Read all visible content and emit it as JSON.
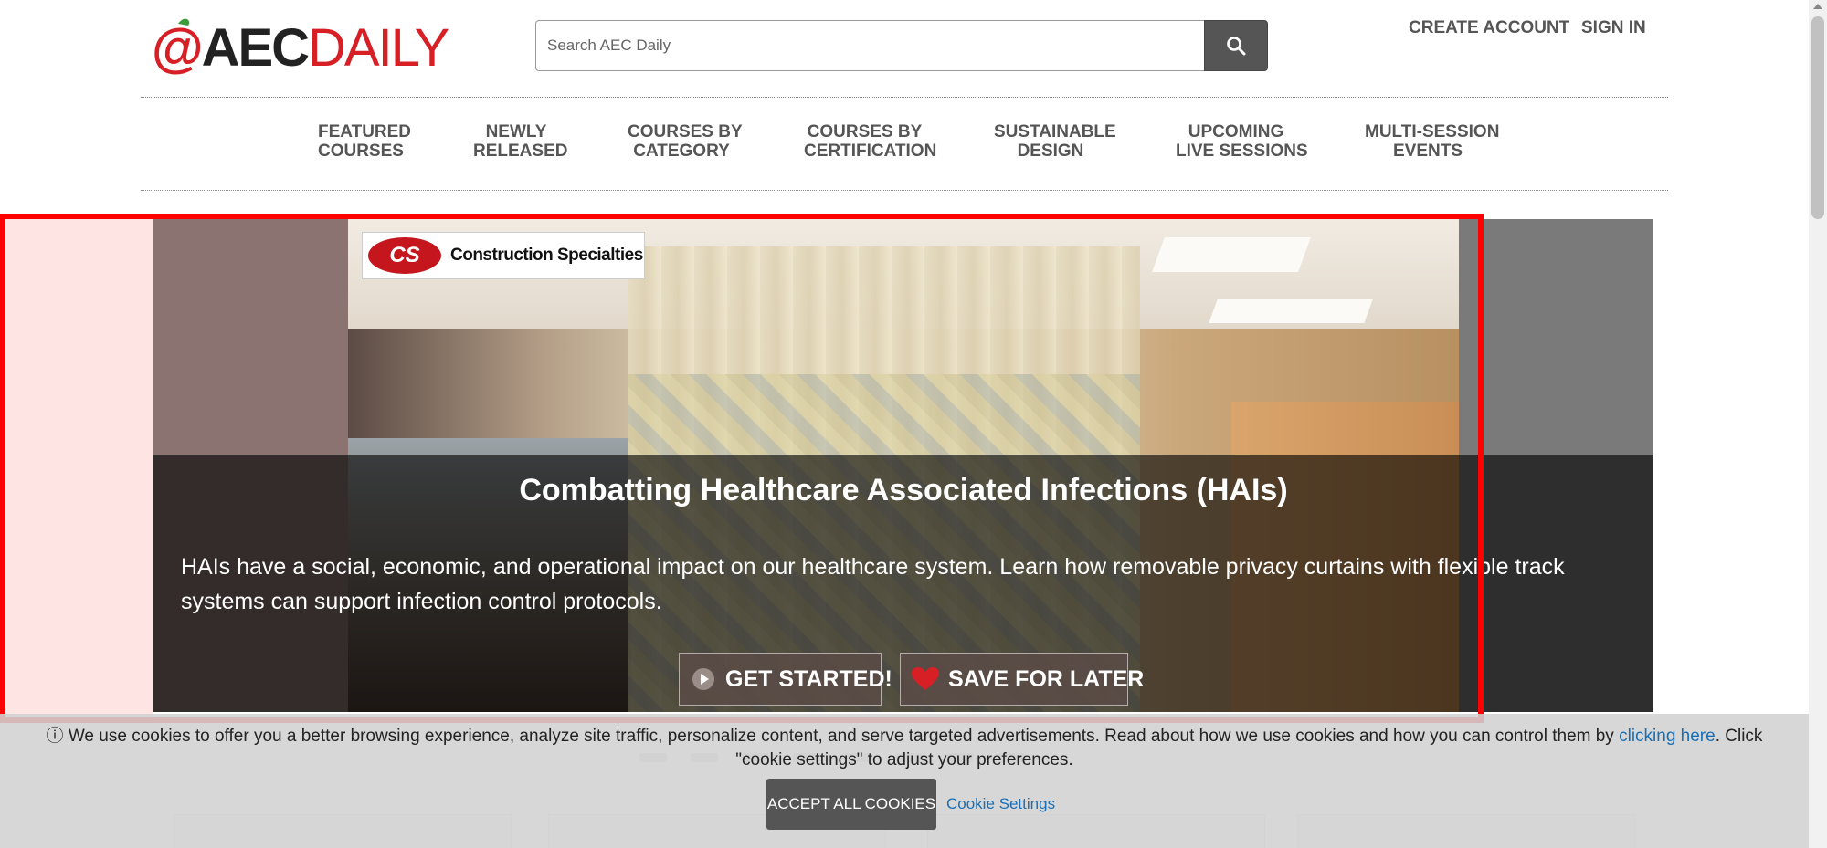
{
  "header": {
    "logo": {
      "at": "@",
      "aec": "AEC",
      "daily": "DAILY"
    },
    "search": {
      "placeholder": "Search AEC Daily",
      "icon": "search-icon"
    },
    "account": {
      "create": "CREATE ACCOUNT",
      "signin": "SIGN IN"
    }
  },
  "nav": {
    "items": [
      {
        "line1": "FEATURED",
        "line2": "COURSES"
      },
      {
        "line1": "NEWLY",
        "line2": "RELEASED"
      },
      {
        "line1": "COURSES BY",
        "line2": "CATEGORY"
      },
      {
        "line1": "COURSES BY",
        "line2": "CERTIFICATION"
      },
      {
        "line1": "SUSTAINABLE",
        "line2": "DESIGN"
      },
      {
        "line1": "UPCOMING",
        "line2": "LIVE SESSIONS"
      },
      {
        "line1": "MULTI-SESSION",
        "line2": "EVENTS"
      }
    ]
  },
  "hero": {
    "sponsor": {
      "mark": "CS",
      "name": "Construction Specialties"
    },
    "title": "Combatting Healthcare Associated Infections (HAIs)",
    "description": "HAIs have a social, economic, and operational impact on our healthcare system. Learn how removable privacy curtains with flexible track systems can support infection control protocols.",
    "get_started": "GET STARTED!",
    "save_later": "SAVE FOR LATER"
  },
  "cookie": {
    "icon": "info-icon",
    "message_before": "We use cookies to offer you a better browsing experience, analyze site traffic, personalize content, and serve targeted advertisements. Read about how we use cookies and how you can control them by ",
    "link": "clicking here",
    "message_after": ". Click \"cookie settings\" to adjust your preferences.",
    "accept": "ACCEPT ALL COOKIES",
    "settings": "Cookie Settings"
  },
  "colors": {
    "brand_red": "#d71f26",
    "link_blue": "#1a6fb5",
    "highlight_red": "#ff0000",
    "button_grey": "#555555"
  }
}
